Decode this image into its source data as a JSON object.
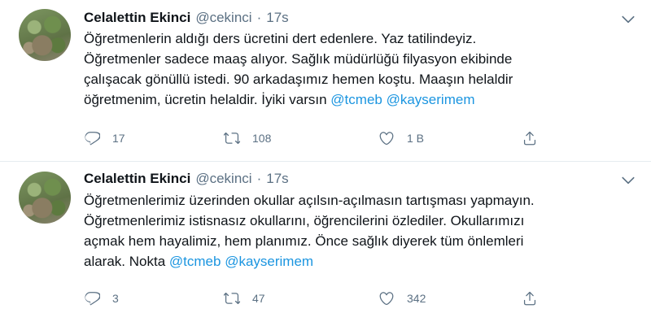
{
  "tweets": [
    {
      "author_name": "Celalettin Ekinci",
      "handle": "@cekinci",
      "separator": "·",
      "time": "17s",
      "text_lines": [
        "Öğretmenlerin aldığı ders ücretini dert edenlere. Yaz tatilindeyiz.",
        "Öğretmenler sadece maaş alıyor. Sağlık müdürlüğü filyasyon ekibinde",
        "çalışacak gönüllü istedi. 90 arkadaşımız hemen koştu. Maaşın helaldir",
        "öğretmenim, ücretin helaldir. İyiki varsın "
      ],
      "mentions": [
        "@tcmeb",
        "@kayserimem"
      ],
      "reply_count": "17",
      "retweet_count": "108",
      "like_count": "1 B",
      "icons": {
        "reply": "reply-icon",
        "retweet": "retweet-icon",
        "like": "heart-icon",
        "share": "share-icon",
        "more": "chevron-down-icon"
      }
    },
    {
      "author_name": "Celalettin Ekinci",
      "handle": "@cekinci",
      "separator": "·",
      "time": "17s",
      "text_lines": [
        "Öğretmenlerimiz üzerinden okullar açılsın-açılmasın tartışması yapmayın.",
        "Öğretmenlerimiz istisnasız okullarını, öğrencilerini özlediler. Okullarımızı",
        "açmak hem hayalimiz, hem planımız. Önce sağlık diyerek tüm önlemleri",
        "alarak. Nokta "
      ],
      "mentions": [
        "@tcmeb",
        "@kayserimem"
      ],
      "reply_count": "3",
      "retweet_count": "47",
      "like_count": "342",
      "icons": {
        "reply": "reply-icon",
        "retweet": "retweet-icon",
        "like": "heart-icon",
        "share": "share-icon",
        "more": "chevron-down-icon"
      }
    }
  ],
  "colors": {
    "text": "#0f1419",
    "secondary": "#5b7083",
    "link": "#1b95e0",
    "divider": "#e6ecf0"
  }
}
